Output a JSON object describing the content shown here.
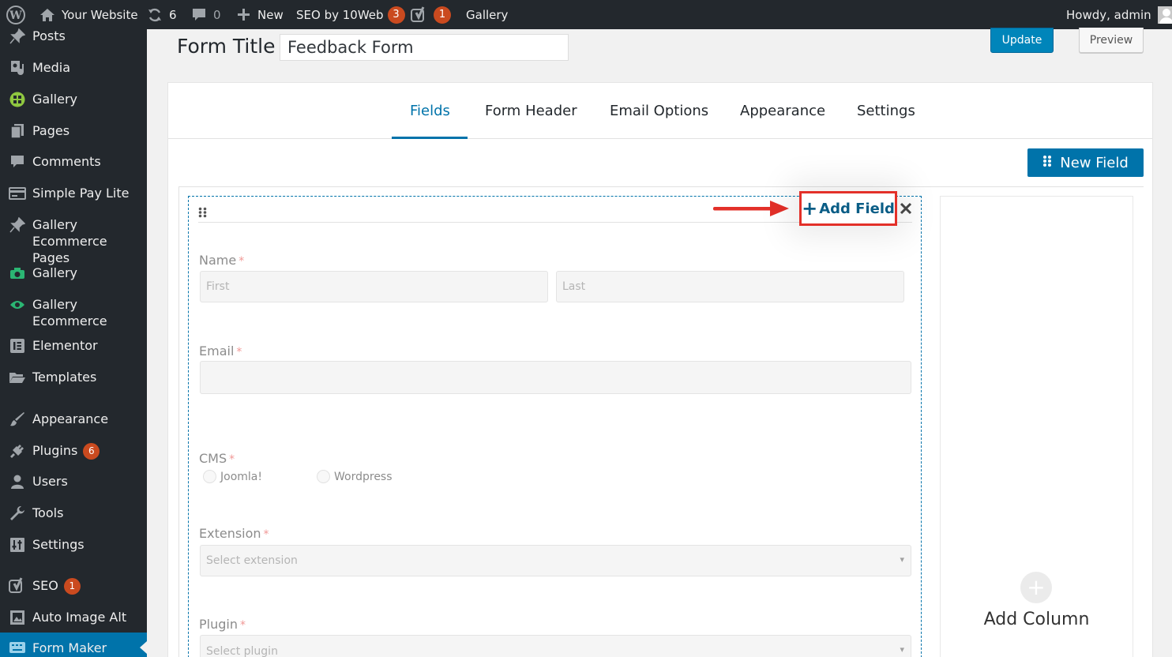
{
  "admin_bar": {
    "site_name": "Your Website",
    "updates_count": "6",
    "comments_count": "0",
    "new_label": "New",
    "seo_label": "SEO by 10Web",
    "seo_badge": "3",
    "yoast_badge": "1",
    "gallery_label": "Gallery",
    "howdy": "Howdy, admin"
  },
  "sidebar": {
    "items": [
      {
        "label": "Posts",
        "icon": "pin-icon"
      },
      {
        "label": "Media",
        "icon": "media-icon"
      },
      {
        "label": "Gallery",
        "icon": "gallery-icon"
      },
      {
        "label": "Pages",
        "icon": "pages-icon"
      },
      {
        "label": "Comments",
        "icon": "comment-icon"
      },
      {
        "label": "Simple Pay Lite",
        "icon": "card-icon"
      },
      {
        "label": "Gallery Ecommerce Pages",
        "icon": "pin-icon"
      },
      {
        "label": "Gallery",
        "icon": "camera-icon"
      },
      {
        "label": "Gallery Ecommerce",
        "icon": "eye-icon"
      },
      {
        "label": "Elementor",
        "icon": "elementor-icon"
      },
      {
        "label": "Templates",
        "icon": "folder-icon"
      },
      {
        "label": "Appearance",
        "icon": "brush-icon"
      },
      {
        "label": "Plugins",
        "icon": "plug-icon",
        "badge": "6"
      },
      {
        "label": "Users",
        "icon": "user-icon"
      },
      {
        "label": "Tools",
        "icon": "wrench-icon"
      },
      {
        "label": "Settings",
        "icon": "settings-icon"
      },
      {
        "label": "SEO",
        "icon": "yoast-icon",
        "badge": "1"
      },
      {
        "label": "Auto Image Alt",
        "icon": "image-alt-icon"
      },
      {
        "label": "Form Maker",
        "icon": "keyboard-icon"
      }
    ]
  },
  "form_title": {
    "label": "Form Title",
    "value": "Feedback Form"
  },
  "actions": {
    "update": "Update",
    "preview": "Preview"
  },
  "tabs": [
    "Fields",
    "Form Header",
    "Email Options",
    "Appearance",
    "Settings"
  ],
  "new_field": "New Field",
  "add_field": "Add Field",
  "fields": {
    "name": {
      "label": "Name",
      "required": "*",
      "first": "First",
      "last": "Last"
    },
    "email": {
      "label": "Email",
      "required": "*"
    },
    "cms": {
      "label": "CMS",
      "required": "*",
      "options": [
        "Joomla!",
        "Wordpress"
      ]
    },
    "extension": {
      "label": "Extension",
      "required": "*",
      "placeholder": "Select extension"
    },
    "plugin": {
      "label": "Plugin",
      "required": "*",
      "placeholder": "Select plugin"
    }
  },
  "add_column": "Add Column",
  "colors": {
    "wp_dark": "#23282d",
    "wp_blue": "#0073aa",
    "highlight_red": "#e33029",
    "badge_orange": "#ca4a1f"
  }
}
